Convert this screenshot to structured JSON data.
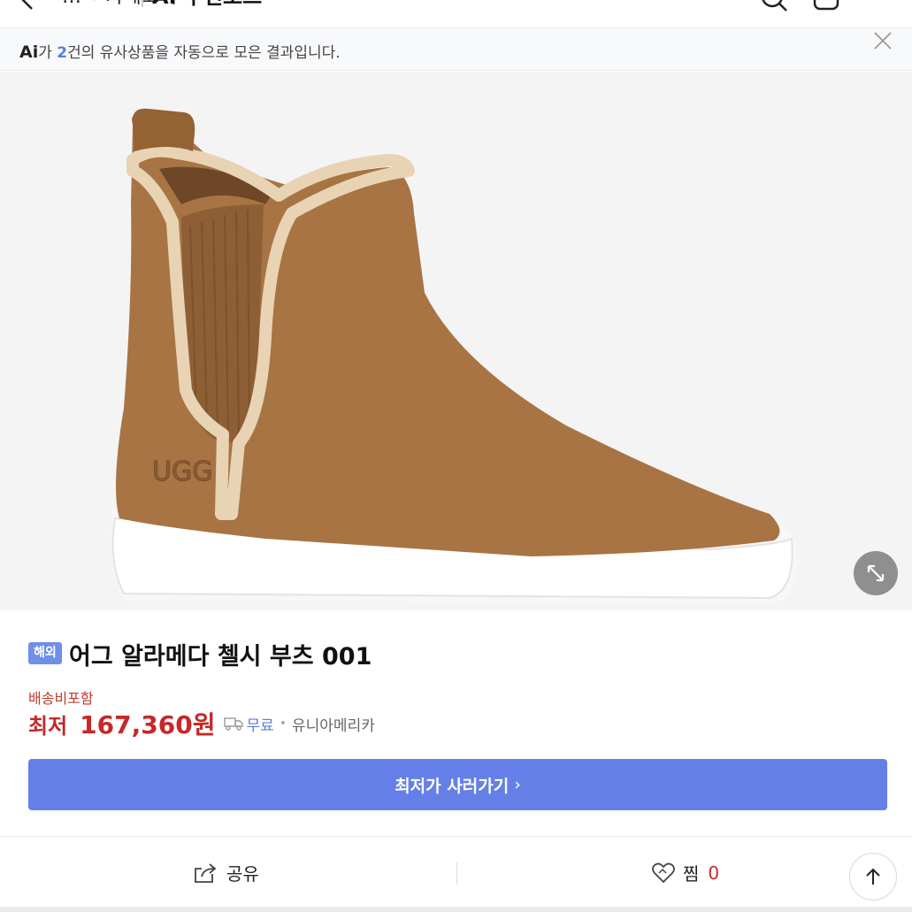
{
  "header": {
    "crumb": "…ㅋ 카테고리",
    "title": "AI 추천보드"
  },
  "ai_banner": {
    "logo": "Ai",
    "prefix": "가 ",
    "count": "2",
    "suffix": "건의 유사상품을 자동으로 모은 결과입니다."
  },
  "product": {
    "badge": "해외",
    "title": "어그 알라메다 첼시 부츠 001",
    "image_brand_mark": "UGG",
    "shipping_note": "배송비포함",
    "price_label": "최저",
    "price": "167,360원",
    "shipping_fee": "무료",
    "seller": "유니아메리카",
    "buy_label": "최저가 사러가기",
    "buy_arrow": "›"
  },
  "actions": {
    "share_label": "공유",
    "like_label": "찜",
    "like_count": "0"
  },
  "colors": {
    "accent": "#6480e8",
    "price": "#c62828",
    "badge": "#6f8fe8"
  },
  "icons": [
    "back-icon",
    "search-icon",
    "cart-icon",
    "menu-icon",
    "close-icon",
    "expand-icon",
    "truck-icon",
    "share-icon",
    "heart-icon",
    "arrow-up-icon"
  ]
}
